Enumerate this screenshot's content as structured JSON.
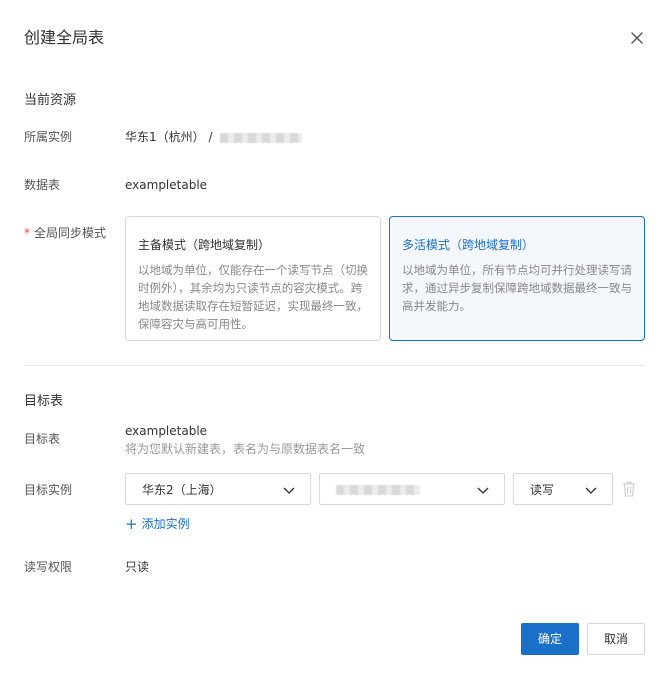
{
  "dialog": {
    "title": "创建全局表",
    "close_icon": "close-icon"
  },
  "current_resource": {
    "section_title": "当前资源",
    "instance_label": "所属实例",
    "instance_region": "华东1（杭州）",
    "instance_separator": "/",
    "table_label": "数据表",
    "table_value": "exampletable",
    "sync_mode_label": "全局同步模式",
    "sync_mode_required": "*",
    "modes": [
      {
        "title": "主备模式（跨地域复制）",
        "description": "以地域为单位，仅能存在一个读写节点（切换时例外），其余均为只读节点的容灾模式。跨地域数据读取存在短暂延迟，实现最终一致，保障容灾与高可用性。",
        "selected": false
      },
      {
        "title": "多活模式（跨地域复制）",
        "description": "以地域为单位，所有节点均可并行处理读写请求，通过异步复制保障跨地域数据最终一致与高并发能力。",
        "selected": true
      }
    ]
  },
  "target": {
    "section_title": "目标表",
    "table_label": "目标表",
    "table_value": "exampletable",
    "table_hint": "将为您默认新建表，表名为与原数据表名一致",
    "instance_label": "目标实例",
    "region_select": "华东2（上海）",
    "permission_select": "读写",
    "add_instance_label": "添加实例",
    "rw_label": "读写权限",
    "rw_value": "只读"
  },
  "footer": {
    "confirm_label": "确定",
    "cancel_label": "取消"
  },
  "colors": {
    "primary": "#1a6fc9",
    "required": "#e34d3b",
    "active_card_bg": "#f4f8fd"
  }
}
